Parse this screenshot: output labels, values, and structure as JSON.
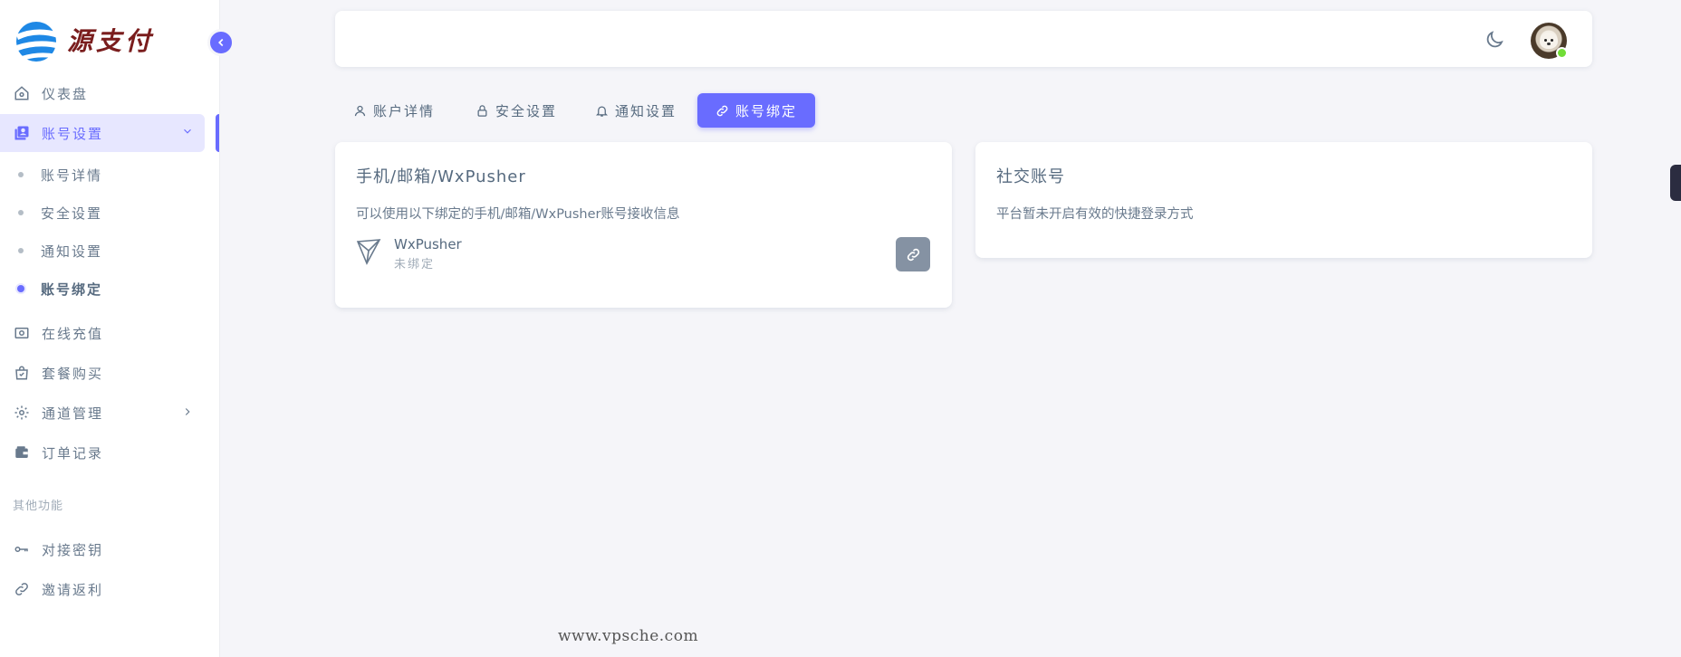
{
  "brand": {
    "name": "源支付",
    "accent": "#696cff"
  },
  "sidebar": {
    "items": [
      {
        "label": "仪表盘",
        "icon": "home-icon"
      },
      {
        "label": "账号设置",
        "icon": "user-box-icon",
        "expanded": true
      },
      {
        "label": "在线充值",
        "icon": "money-icon"
      },
      {
        "label": "套餐购买",
        "icon": "shopping-bag-icon"
      },
      {
        "label": "通道管理",
        "icon": "gear-icon"
      },
      {
        "label": "订单记录",
        "icon": "wallet-icon"
      }
    ],
    "sub_items": [
      {
        "label": "账号详情"
      },
      {
        "label": "安全设置"
      },
      {
        "label": "通知设置"
      },
      {
        "label": "账号绑定",
        "current": true
      }
    ],
    "section_other": "其他功能",
    "other_items": [
      {
        "label": "对接密钥",
        "icon": "key-icon"
      },
      {
        "label": "邀请返利",
        "icon": "link-icon"
      }
    ]
  },
  "navbar": {
    "theme_icon": "moon-icon",
    "avatar_status": "online"
  },
  "tabs": [
    {
      "label": "账户详情",
      "icon": "user-icon"
    },
    {
      "label": "安全设置",
      "icon": "lock-icon"
    },
    {
      "label": "通知设置",
      "icon": "bell-icon"
    },
    {
      "label": "账号绑定",
      "icon": "link-icon",
      "active": true
    }
  ],
  "binding_card": {
    "title": "手机/邮箱/WxPusher",
    "description": "可以使用以下绑定的手机/邮箱/WxPusher账号接收信息",
    "item": {
      "name": "WxPusher",
      "status": "未绑定",
      "icon": "paper-plane-icon",
      "action_icon": "link-icon"
    }
  },
  "social_card": {
    "title": "社交账号",
    "description": "平台暂未开启有效的快捷登录方式"
  },
  "watermark": "www.vpsche.com"
}
